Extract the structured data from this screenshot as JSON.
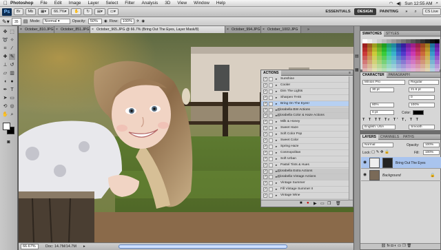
{
  "menubar": {
    "app": "Photoshop",
    "items": [
      "File",
      "Edit",
      "Image",
      "Layer",
      "Select",
      "Filter",
      "Analysis",
      "3D",
      "View",
      "Window",
      "Help"
    ],
    "clock": "Sun 12:55 AM"
  },
  "appbar": {
    "logo": "Ps",
    "zoom": "66.7",
    "workspaces": [
      "ESSENTIALS",
      "DESIGN",
      "PAINTING"
    ],
    "active_workspace": "DESIGN",
    "cs_live": "CS Live"
  },
  "options": {
    "brush_size": "35",
    "mode_label": "Mode:",
    "mode_value": "Normal",
    "opacity_label": "Opacity:",
    "opacity_value": "50%",
    "flow_label": "Flow:",
    "flow_value": "100%"
  },
  "document_tabs": [
    {
      "label": "October_810.JPG",
      "active": false
    },
    {
      "label": "October_851.JPG",
      "active": false
    },
    {
      "label": "October_965.JPG @ 66.7% (Bring Out The Eyes, Layer Mask/8)",
      "active": true
    },
    {
      "label": "October_994.JPG",
      "active": false
    },
    {
      "label": "October_1002.JPG",
      "active": false
    }
  ],
  "window_title": "October_965.JPG @ 66.7% (Bring Out The Eyes, Layer Mask/8)",
  "status": {
    "zoom": "66.67%",
    "doc": "Doc: 14.7M/14.7M"
  },
  "actions_panel": {
    "title": "ACTIONS",
    "rows": [
      {
        "label": "Sunshine",
        "type": "action"
      },
      {
        "label": "Cooler",
        "type": "action"
      },
      {
        "label": "Dim The Lights",
        "type": "action"
      },
      {
        "label": "Sharpen THIS",
        "type": "action"
      },
      {
        "label": "Bring On The Eyes!",
        "type": "action",
        "selected": true
      },
      {
        "label": "Florabella BW Actions",
        "type": "set"
      },
      {
        "label": "Florabella Color & Haze Actions",
        "type": "set"
      },
      {
        "label": "Milk & Honey",
        "type": "action"
      },
      {
        "label": "Sweet Haze",
        "type": "action"
      },
      {
        "label": "Soft Color Pop",
        "type": "action"
      },
      {
        "label": "Sweet Color",
        "type": "action"
      },
      {
        "label": "Spring Haze",
        "type": "action"
      },
      {
        "label": "Cosmopolitan",
        "type": "action"
      },
      {
        "label": "Soft Urban",
        "type": "action"
      },
      {
        "label": "Pastel Tints & Hues",
        "type": "action"
      },
      {
        "label": "Florabella Extra Actions",
        "type": "set"
      },
      {
        "label": "Florabella Vintage Actions",
        "type": "set"
      },
      {
        "label": "Vintage Summer",
        "type": "action"
      },
      {
        "label": "Fill Vintage Summer II",
        "type": "action"
      },
      {
        "label": "Vintage Wine",
        "type": "action"
      }
    ]
  },
  "right_panels": {
    "swatches_tabs": [
      "SWATCHES",
      "STYLES"
    ],
    "character_tabs": [
      "CHARACTER",
      "PARAGRAPH"
    ],
    "font_family": "Minion Pro",
    "font_style": "Regular",
    "font_size": "30 pt",
    "leading": "21.6 pt",
    "tracking": "0",
    "kerning_scale": "100%",
    "vertical_scale": "80%",
    "baseline": "0 pt",
    "color_label": "Color:",
    "language": "English: USA",
    "antialias": "Smooth",
    "layers_tabs": [
      "LAYERS",
      "CHANNELS",
      "PATHS"
    ],
    "blend_mode": "Normal",
    "opacity_label": "Opacity:",
    "opacity": "100%",
    "lock_label": "Lock:",
    "fill_label": "Fill:",
    "fill": "100%",
    "layers": [
      {
        "name": "Bring Out The Eyes",
        "selected": true,
        "mask": true
      },
      {
        "name": "Background",
        "selected": false,
        "mask": false
      }
    ]
  },
  "colors": {
    "selection_blue": "#b6d0f2",
    "panel_bg": "#d6d6d6",
    "app_dark": "#4a4a4a"
  }
}
